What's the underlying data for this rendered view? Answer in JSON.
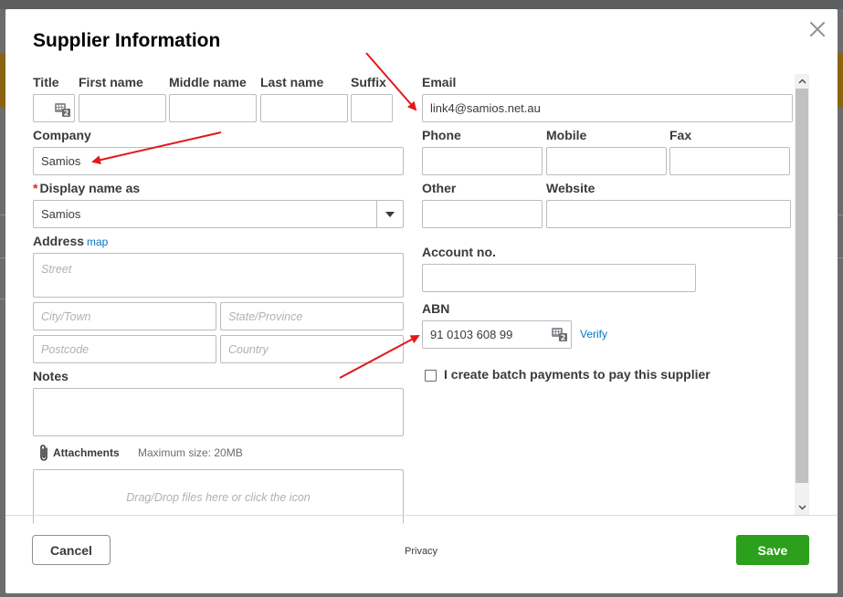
{
  "dialog": {
    "title": "Supplier Information"
  },
  "name_fields": {
    "title_label": "Title",
    "first_label": "First name",
    "middle_label": "Middle name",
    "last_label": "Last name",
    "suffix_label": "Suffix"
  },
  "company": {
    "label": "Company",
    "value": "Samios"
  },
  "display_name": {
    "label": "Display name as",
    "value": "Samios"
  },
  "address": {
    "label": "Address",
    "map_link": "map",
    "street_placeholder": "Street",
    "city_placeholder": "City/Town",
    "state_placeholder": "State/Province",
    "postcode_placeholder": "Postcode",
    "country_placeholder": "Country"
  },
  "notes": {
    "label": "Notes"
  },
  "attachments": {
    "label": "Attachments",
    "max_size": "Maximum size: 20MB",
    "dropzone_text": "Drag/Drop files here or click the icon"
  },
  "contact": {
    "email_label": "Email",
    "email_value": "link4@samios.net.au",
    "phone_label": "Phone",
    "mobile_label": "Mobile",
    "fax_label": "Fax",
    "other_label": "Other",
    "website_label": "Website"
  },
  "account": {
    "label": "Account no."
  },
  "abn": {
    "label": "ABN",
    "value": "91 0103 608 99",
    "verify_link": "Verify"
  },
  "batch_payments": {
    "label": "I create batch payments to pay this supplier",
    "checked": false
  },
  "footer": {
    "cancel_label": "Cancel",
    "privacy_label": "Privacy",
    "save_label": "Save"
  },
  "colors": {
    "save": "#2ca01c",
    "link": "#0077c5",
    "annotation_arrow": "#e0191b",
    "required": "#d52b1e"
  }
}
